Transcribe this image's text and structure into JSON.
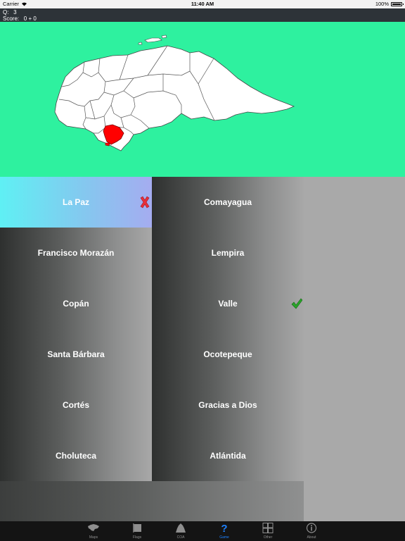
{
  "status_bar": {
    "carrier": "Carrier",
    "time": "11:40 AM",
    "battery_percent": "100%"
  },
  "game_info": {
    "question_label": "Q:",
    "question_value": "3",
    "score_label": "Score:",
    "score_value": "0 + 0"
  },
  "map": {
    "country_fill": "#ffffff",
    "highlight_fill": "#ff0000",
    "background": "#2ef19f"
  },
  "answers": {
    "left": [
      {
        "label": "La Paz",
        "status": "wrong"
      },
      {
        "label": "Francisco Morazán"
      },
      {
        "label": "Copán"
      },
      {
        "label": "Santa Bárbara"
      },
      {
        "label": "Cortés"
      },
      {
        "label": "Choluteca"
      }
    ],
    "right": [
      {
        "label": "Comayagua"
      },
      {
        "label": "Lempira"
      },
      {
        "label": "Valle",
        "status": "correct"
      },
      {
        "label": "Ocotepeque"
      },
      {
        "label": "Gracias a Dios"
      },
      {
        "label": "Atlántida"
      }
    ]
  },
  "tabs": [
    {
      "label": "Maps",
      "icon": "map-icon"
    },
    {
      "label": "Flags",
      "icon": "flag-icon"
    },
    {
      "label": "COA",
      "icon": "coat-of-arms-icon"
    },
    {
      "label": "Game",
      "icon": "question-icon",
      "active": true
    },
    {
      "label": "Other",
      "icon": "grid-icon"
    },
    {
      "label": "About",
      "icon": "info-icon"
    }
  ],
  "colors": {
    "accent": "#1e82ff",
    "wrong": "#e8303a",
    "correct": "#2aa52a"
  }
}
